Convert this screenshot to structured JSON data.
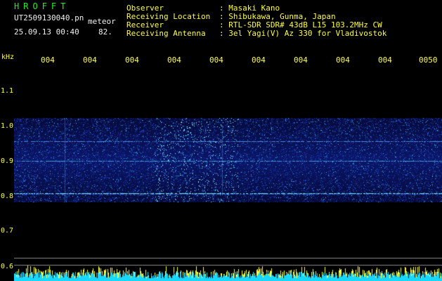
{
  "header": {
    "app_name": "HROFFT",
    "filename": "UT2509130040.pn",
    "mode": "meteor",
    "date_time": "25.09.13 00:40",
    "value": "82."
  },
  "info": {
    "rows": [
      {
        "label": "Observer",
        "value": ": Masaki Kano"
      },
      {
        "label": "Receiving Location",
        "value": ": Shibukawa, Gunma, Japan"
      },
      {
        "label": "Receiver",
        "value": ": RTL-SDR SDR# 43dB L15 103.2MHz CW"
      },
      {
        "label": "Receiving Antenna",
        "value": ": 3el Yagi(V) Az 330 for Vladivostok"
      }
    ]
  },
  "axis": {
    "unit": "kHz",
    "x_ticks": [
      "004",
      "004",
      "004",
      "004",
      "004",
      "004",
      "004",
      "004",
      "004",
      "0050"
    ],
    "y_ticks": [
      "1.1",
      "1.0",
      "0.9",
      "0.8",
      "0.7",
      "0.6"
    ]
  },
  "colors": {
    "background": "#000000",
    "label_yellow": "#ffff3c",
    "app_green": "#2ee82e",
    "text_white": "#f0f0f0",
    "spectrum_base": "#0b1a80",
    "spectrum_bright": "#6fe8ff",
    "meter_cyan": "#19d8ff",
    "meter_yellow": "#ffff3c"
  }
}
